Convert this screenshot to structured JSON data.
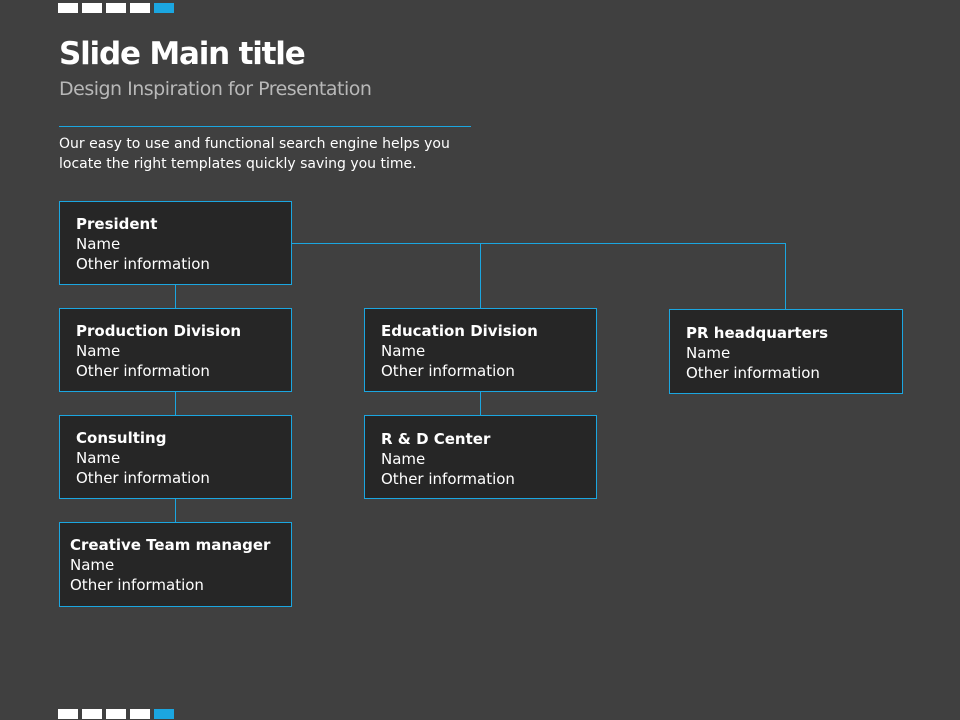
{
  "slide": {
    "title": "Slide Main title",
    "subtitle": "Design Inspiration for Presentation",
    "description_lines": [
      "Our easy to use and functional search engine helps you",
      "locate the right templates quickly saving you time."
    ]
  },
  "decor": {
    "square_color": "#ffffff",
    "accent_color": "#1ba6e0",
    "background_color": "#404040",
    "node_fill_color": "#262626"
  },
  "org_chart": {
    "nodes": [
      {
        "id": "president",
        "role": "President",
        "name": "Name",
        "info": "Other information",
        "parent": null
      },
      {
        "id": "production",
        "role": "Production Division",
        "name": "Name",
        "info": "Other information",
        "parent": "president"
      },
      {
        "id": "education",
        "role": "Education Division",
        "name": "Name",
        "info": "Other information",
        "parent": "president"
      },
      {
        "id": "pr",
        "role": "PR headquarters",
        "name": "Name",
        "info": "Other information",
        "parent": "president"
      },
      {
        "id": "consulting",
        "role": "Consulting",
        "name": "Name",
        "info": "Other information",
        "parent": "production"
      },
      {
        "id": "rnd",
        "role": "R & D Center",
        "name": "Name",
        "info": "Other information",
        "parent": "education"
      },
      {
        "id": "creative",
        "role": "Creative Team manager",
        "name": "Name",
        "info": "Other information",
        "parent": "consulting"
      }
    ]
  }
}
